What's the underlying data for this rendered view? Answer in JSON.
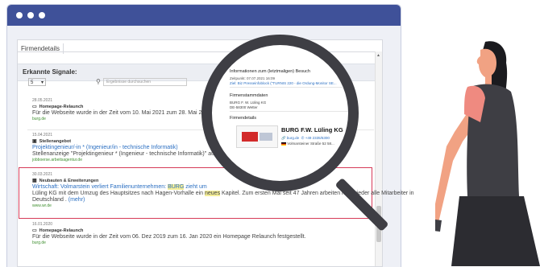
{
  "window": {
    "tab_label": "Firmendetails"
  },
  "section": {
    "title": "Erkannte Signale:"
  },
  "controls": {
    "page_size": "5",
    "search_placeholder": "Ergebnisse durchsuchen"
  },
  "signals": [
    {
      "date": "28.05.2021",
      "type": "Homepage-Relaunch",
      "type_icon": "monitor-icon",
      "body": "Für die Webseite wurde in der Zeit vom 10. Mai 2021 zum 28. Mai 2021 ein Ho",
      "source": "burg.de"
    },
    {
      "date": "15.04.2021",
      "type": "Stellenangebot",
      "type_icon": "briefcase-icon",
      "link": "Projektingenieur/-in * (Ingenieur/in - technische Informatik)",
      "body": "Stellenanzeige \"Projektingenieur * (Ingenieur - technische Informatik)\" auf arbeitsagen",
      "source": "jobboerse.arbeitsagentur.de"
    },
    {
      "date": "30.03.2021",
      "type": "Neubauten & Erweiterungen",
      "type_icon": "building-icon",
      "link_pre": "Wirtschaft: Volmarstein verliert Familienunternehmen: ",
      "link_hl": "BURG",
      "link_post": " zieht um",
      "body1_pre": "Lüling KG mit dem Umzug des Hauptsitzes nach Hagen-Vorhalle ein ",
      "body1_hl": "neues",
      "body1_post": " Kapitel. Zum ersten Mal seit 47 Jahren arbeiten nun wieder alle Mitarbeiter in",
      "body2": "Deutschland . ",
      "more": "(mehr)",
      "source": "www.wr.de"
    },
    {
      "date": "16.01.2020",
      "type": "Homepage-Relaunch",
      "type_icon": "monitor-icon",
      "body": "Für die Webseite wurde in der Zeit vom 06. Dez 2019 zum 16. Jan 2020 ein Homepage Relaunch festgestellt.",
      "source": "burg.de"
    }
  ],
  "lens": {
    "visit_title": "Informationen zum (letztmaligen) Besuch",
    "visit_time": "Zeitpunkt: 07.07.2021 16:09",
    "visit_via": "Ziel: Biz Presseinfoblock (\"TURNIS 220 - die Ordung-Monitor SE...",
    "master_title": "Firmenstammdaten",
    "master_name": "BURG F. W. Lüling KG",
    "master_city": "DE-58300 Wetter",
    "details_title": "Firmendetails",
    "company_name": "BURG F.W. Lüling KG",
    "company_site": "burg.de",
    "company_phone": "+49 2335/6300",
    "company_address": "Volmarsteiner Straße 52 58..."
  },
  "colors": {
    "titlebar": "#3f5199",
    "highlight_border": "#d63b58",
    "link": "#2b6fc2",
    "source": "#3f8f2f",
    "marker": "#f4ee99"
  }
}
